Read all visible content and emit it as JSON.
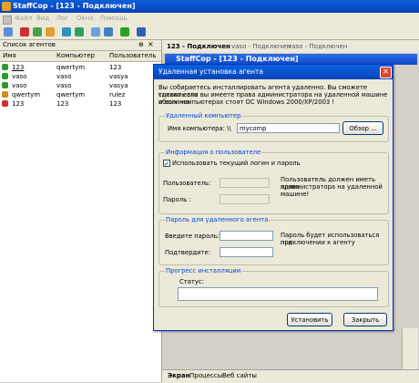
{
  "app": {
    "title": "StaffCop - [123 - Подключен]",
    "menu": [
      "Файл",
      "Вид",
      "Лог",
      "Окно",
      "Помощь"
    ]
  },
  "left_panel": {
    "title": "Список агентов",
    "pin_icon": "⊕",
    "close_icon": "×",
    "columns": [
      "Имя",
      "Компьютер",
      "Пользователь"
    ],
    "rows": [
      {
        "name": "123",
        "computer": "qwertym",
        "user": "123",
        "status_color": "#2e9a2e"
      },
      {
        "name": "vaso",
        "computer": "vaso",
        "user": "vasya",
        "status_color": "#2e9a2e"
      },
      {
        "name": "vaso",
        "computer": "vaso",
        "user": "vasya",
        "status_color": "#2e9a2e"
      },
      {
        "name": "qwertym",
        "computer": "qwertym",
        "user": "rulez",
        "status_color": "#d98a1a"
      },
      {
        "name": "123",
        "computer": "123",
        "user": "123",
        "status_color": "#cc3030"
      }
    ]
  },
  "tabs": [
    "123 - Подключен",
    "vaso - Подключен",
    "vaso - Подключен"
  ],
  "bg_window_title": "StaffCop - [123 - Подключен]",
  "bottom_tabs": [
    "Экран",
    "Процессы",
    "Веб сайты"
  ],
  "dialog": {
    "title": "Удаленная установка агента",
    "info_lines": [
      "Вы собираетесь инсталлировать агента удаленно. Вы сможете сделать это",
      "только если вы имеете права администратора на удаленной машине и если на",
      "обоих компьютерах стоят ОС Windows 2000/XP/2003 !"
    ],
    "remote_group": {
      "label": "Удаленный компьютер",
      "computer_label": "Имя компьютера: \\\\",
      "computer_value": "mycomp",
      "browse_button": "Обзор ..."
    },
    "user_group": {
      "label": "Информация о пользователе",
      "checkbox_label": "Использовать текущий логин и пароль",
      "checked": true,
      "user_label": "Пользователь:",
      "password_label": "Пароль :",
      "note_lines": [
        "Пользователь должен иметь права",
        "администратора на удаленной",
        "машине!"
      ]
    },
    "password_group": {
      "label": "Пароль для удаленного агента",
      "enter_label": "Введите пароль:",
      "confirm_label": "Подтвердите:",
      "note_lines": [
        "Пароль будет использоваться при",
        "подключении к агенту"
      ]
    },
    "progress_group": {
      "label": "Прогресс инсталляции",
      "status_label": "Статус:"
    },
    "install_button": "Установить",
    "close_button": "Закрыть"
  }
}
